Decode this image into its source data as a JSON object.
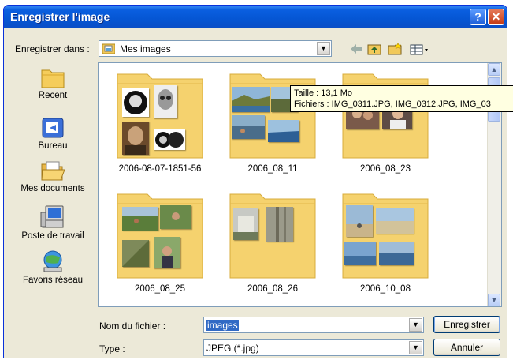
{
  "window": {
    "title": "Enregistrer l'image"
  },
  "savein": {
    "label": "Enregistrer dans :",
    "value": "Mes images"
  },
  "places": [
    {
      "label": "Recent",
      "icon": "folder-clock-icon"
    },
    {
      "label": "Bureau",
      "icon": "desktop-icon"
    },
    {
      "label": "Mes documents",
      "icon": "folder-open-icon"
    },
    {
      "label": "Poste de travail",
      "icon": "computer-icon"
    },
    {
      "label": "Favoris réseau",
      "icon": "network-icon"
    }
  ],
  "folders": [
    {
      "name": "2006-08-07-1851-56"
    },
    {
      "name": "2006_08_11"
    },
    {
      "name": "2006_08_23"
    },
    {
      "name": "2006_08_25"
    },
    {
      "name": "2006_08_26"
    },
    {
      "name": "2006_10_08"
    }
  ],
  "tooltip": {
    "size": "Taille : 13,1 Mo",
    "files": "Fichiers : IMG_0311.JPG, IMG_0312.JPG, IMG_03"
  },
  "filename": {
    "label": "Nom du fichier :",
    "value": "images"
  },
  "filetype": {
    "label": "Type :",
    "value": "JPEG (*.jpg)"
  },
  "buttons": {
    "save": "Enregistrer",
    "cancel": "Annuler"
  },
  "colors": {
    "titlebar": "#0556d4",
    "folder": "#f6d46e",
    "selection": "#316ac5"
  }
}
